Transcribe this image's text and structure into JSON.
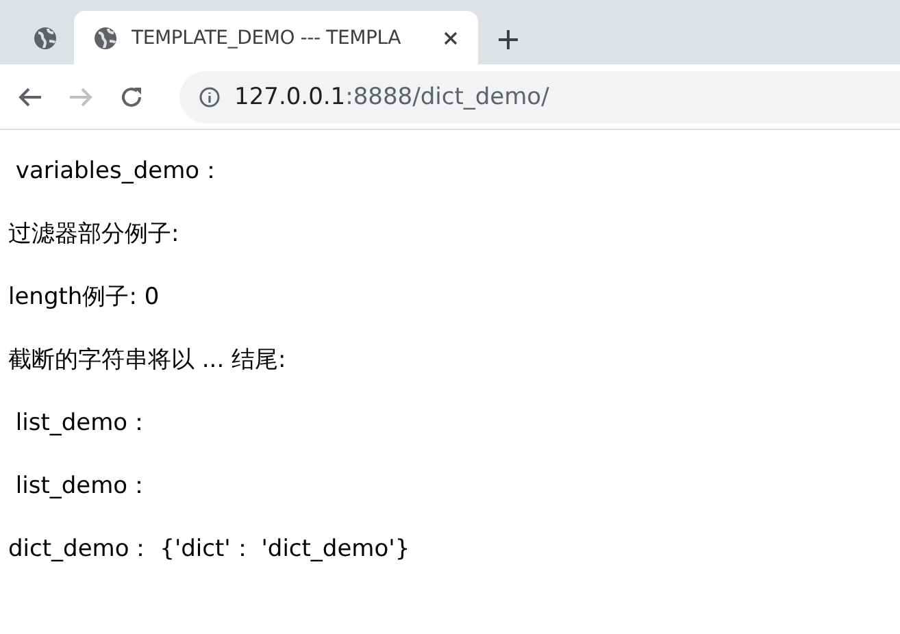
{
  "tabs": [
    {
      "selected": false
    },
    {
      "title": "TEMPLATE_DEMO --- TEMPLA",
      "selected": true
    }
  ],
  "toolbar": {
    "back_disabled": false,
    "forward_disabled": true
  },
  "address": {
    "host": "127.0.0.1",
    "path": ":8888/dict_demo/"
  },
  "paragraphs": [
    " variables_demo：",
    "过滤器部分例子:",
    "length例子: 0",
    "截断的字符串将以 ... 结尾:",
    " list_demo：",
    " list_demo：",
    "dict_demo： {'dict'： 'dict_demo'}"
  ]
}
